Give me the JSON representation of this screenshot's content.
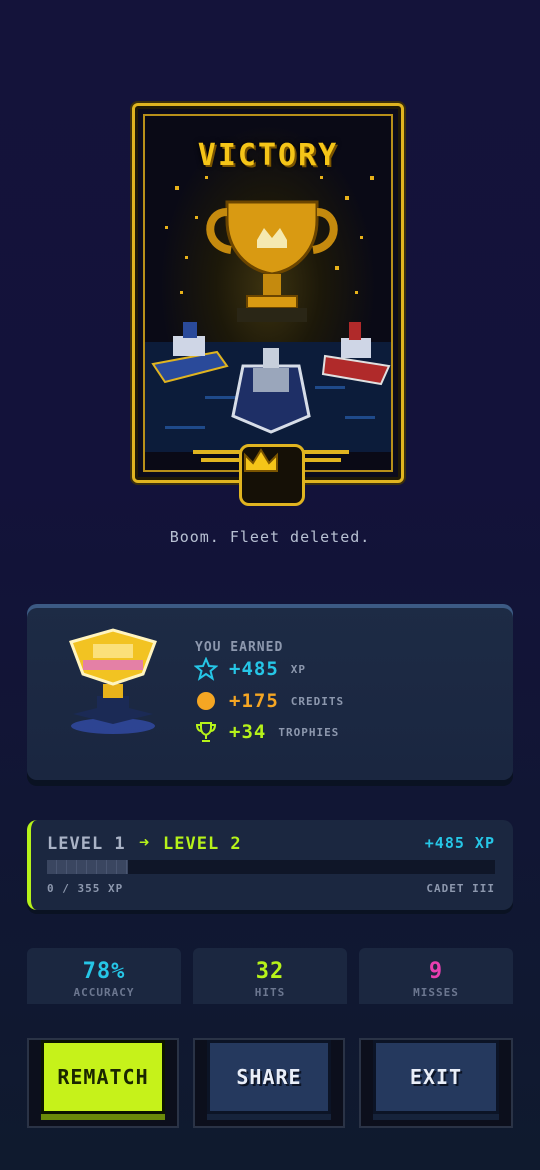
{
  "card": {
    "title": "VICTORY"
  },
  "tagline": "Boom. Fleet deleted.",
  "rewards": {
    "heading": "YOU EARNED",
    "items": [
      {
        "icon": "star-icon",
        "value": "+485",
        "unit": "XP",
        "color": "#26c6e6"
      },
      {
        "icon": "coin-icon",
        "value": "+175",
        "unit": "CREDITS",
        "color": "#f5a623"
      },
      {
        "icon": "trophy-icon",
        "value": "+34",
        "unit": "TROPHIES",
        "color": "#b6f21a"
      }
    ]
  },
  "level": {
    "from": "LEVEL 1",
    "to": "LEVEL 2",
    "xp_gain": "+485 XP",
    "current": "0 / 355 XP",
    "rank": "CADET III",
    "progress": 0.18
  },
  "stats": [
    {
      "value": "78%",
      "label": "ACCURACY",
      "color": "#26c6e6"
    },
    {
      "value": "32",
      "label": "HITS",
      "color": "#b6f21a"
    },
    {
      "value": "9",
      "label": "MISSES",
      "color": "#e83fb0"
    }
  ],
  "buttons": {
    "rematch": "REMATCH",
    "share": "SHARE",
    "exit": "EXIT"
  },
  "colors": {
    "accent": "#b6f21a",
    "gold": "#f5c518",
    "panel": "#1b2740"
  }
}
